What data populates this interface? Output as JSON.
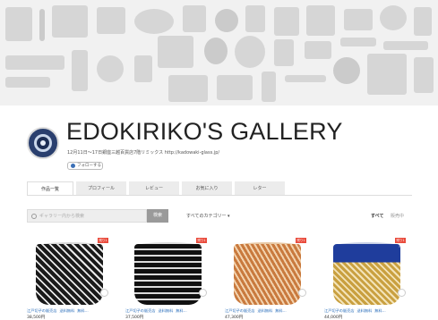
{
  "shop": {
    "title": "EDOKIRIKO'S GALLERY",
    "description": "12月11日〜17日銀座三越百貨店7階リミックス http://kadowaki-glass.jp/",
    "follow_label": "フォローする"
  },
  "tabs": [
    {
      "label": "作品一覧",
      "active": true
    },
    {
      "label": "プロフィール",
      "active": false
    },
    {
      "label": "レビュー",
      "active": false
    },
    {
      "label": "お気に入り",
      "active": false
    },
    {
      "label": "レター",
      "active": false
    }
  ],
  "search": {
    "placeholder": "ギャラリー内から検索",
    "button_label": "検索",
    "category_label": "すべてのカテゴリー ▾"
  },
  "filters": {
    "all_label": "すべて",
    "sale_label": "販売中"
  },
  "products": [
    {
      "badge": "残り1点",
      "shop": "江戸切子の販売店",
      "shipping": "送料無料",
      "extra": "無料...",
      "price": "38,500円"
    },
    {
      "badge": "残り1点",
      "shop": "江戸切子の販売店",
      "shipping": "送料無料",
      "extra": "無料...",
      "price": "37,500円"
    },
    {
      "badge": "残り1点",
      "shop": "江戸切子の販売店",
      "shipping": "送料無料",
      "extra": "無料...",
      "price": "47,300円"
    },
    {
      "badge": "残り1点",
      "shop": "江戸切子の販売店",
      "shipping": "送料無料",
      "extra": "無料...",
      "price": "44,000円"
    }
  ],
  "colors": {
    "banner_bg": "#f1f1f1",
    "link_blue": "#2a6ebb",
    "badge_red": "#e94a3b"
  }
}
